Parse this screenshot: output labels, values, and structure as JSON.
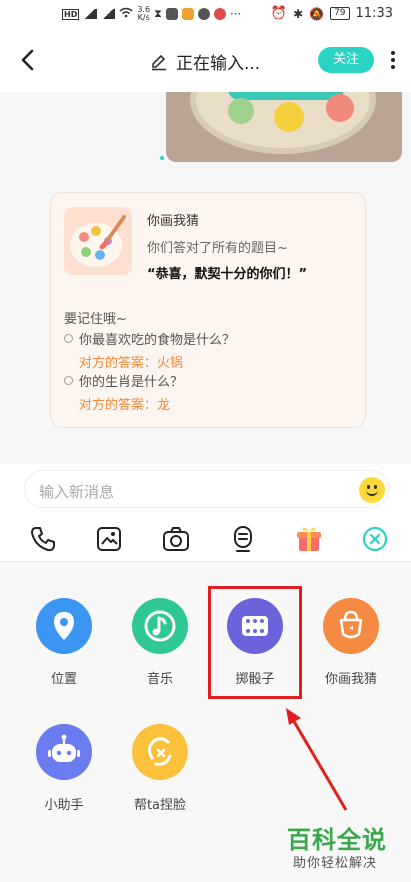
{
  "status_bar": {
    "network": "HD",
    "speed": "3.6\nK/s",
    "battery": "79",
    "time": "11:33"
  },
  "header": {
    "title": "正在输入...",
    "follow_label": "关注"
  },
  "game_card": {
    "name": "你画我猜",
    "subtitle": "你们答对了所有的题目~",
    "quote": "“恭喜，默契十分的你们！”",
    "remember": "要记住哦~",
    "qa": [
      {
        "question": "你最喜欢吃的食物是什么？",
        "answer": "对方的答案：火锅"
      },
      {
        "question": "你的生肖是什么？",
        "answer": "对方的答案：龙"
      }
    ]
  },
  "input": {
    "placeholder": "输入新消息"
  },
  "toolbar": [
    "phone-icon",
    "image-icon",
    "camera-icon",
    "voice-icon",
    "gift-icon",
    "close-icon"
  ],
  "apps": [
    {
      "label": "位置",
      "icon": "location-icon",
      "color": "#3b96f2"
    },
    {
      "label": "音乐",
      "icon": "music-icon",
      "color": "#2fc792"
    },
    {
      "label": "掷骰子",
      "icon": "dice-icon",
      "color": "#6a63d9"
    },
    {
      "label": "你画我猜",
      "icon": "draw-guess-icon",
      "color": "#f58a42"
    },
    {
      "label": "小助手",
      "icon": "robot-icon",
      "color": "#6a7cf0"
    },
    {
      "label": "帮ta捏脸",
      "icon": "face-pinch-icon",
      "color": "#fbc13a"
    }
  ],
  "watermark": {
    "main": "百科全说",
    "sub": "助你轻松解决"
  }
}
